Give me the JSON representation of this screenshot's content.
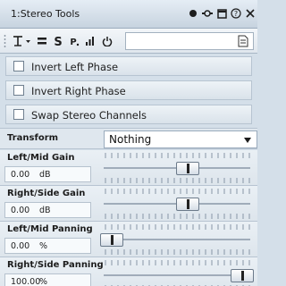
{
  "window": {
    "title": "1:Stereo Tools"
  },
  "titlebar_icons": [
    "dot-icon",
    "pin-icon",
    "restore-icon",
    "help-icon",
    "close-icon"
  ],
  "toolbar": {
    "tools": [
      "preset-menu-icon",
      "compare-icon",
      "stream-icon",
      "bypass-icon",
      "meter-icon",
      "power-icon"
    ],
    "search_value": ""
  },
  "options": [
    {
      "label": "Invert Left Phase",
      "checked": false
    },
    {
      "label": "Invert Right Phase",
      "checked": false
    },
    {
      "label": "Swap Stereo Channels",
      "checked": false
    }
  ],
  "transform": {
    "label": "Transform",
    "value": "Nothing"
  },
  "sliders": [
    {
      "label": "Left/Mid Gain",
      "value": "0.00",
      "unit": "dB",
      "position": 0.58
    },
    {
      "label": "Right/Side Gain",
      "value": "0.00",
      "unit": "dB",
      "position": 0.58
    },
    {
      "label": "Left/Mid Panning",
      "value": "0.00",
      "unit": "%",
      "position": 0.0
    },
    {
      "label": "Right/Side Panning",
      "value": "100.00",
      "unit": "%",
      "position": 1.0
    }
  ]
}
